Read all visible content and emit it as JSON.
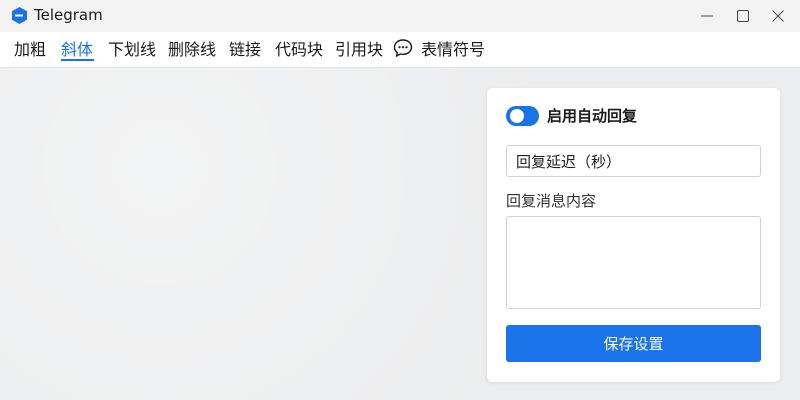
{
  "window": {
    "title": "Telegram",
    "icon": "telegram-hexagon-icon",
    "controls": [
      "minimize-icon",
      "maximize-icon",
      "close-icon"
    ]
  },
  "toolbar": {
    "items": [
      {
        "label": "加粗"
      },
      {
        "label": "斜体",
        "active": true
      },
      {
        "label": "下划线"
      },
      {
        "label": "删除线"
      },
      {
        "label": "链接"
      },
      {
        "label": "代码块"
      },
      {
        "label": "引用块"
      },
      {
        "label": "表情符号",
        "icon": "speech-bubble-icon"
      }
    ]
  },
  "panel": {
    "toggle": {
      "label": "启用自动回复",
      "on": true
    },
    "delay_input": {
      "value": "回复延迟（秒）"
    },
    "content_label": "回复消息内容",
    "content_value": "",
    "save_label": "保存设置"
  },
  "colors": {
    "accent": "#1a73e8",
    "background": "#eeeff0",
    "panel": "#ffffff"
  }
}
